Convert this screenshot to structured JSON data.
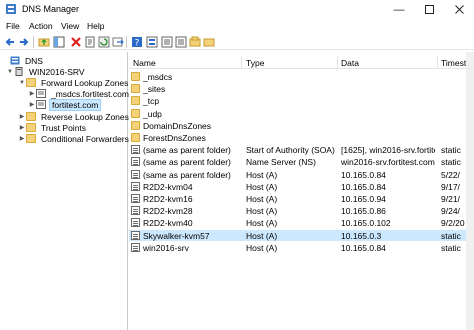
{
  "window": {
    "title": "DNS Manager"
  },
  "menu": [
    "File",
    "Action",
    "View",
    "Help"
  ],
  "toolbar": [
    "back-icon",
    "forward-icon",
    "up-folder-icon",
    "show-hide-tree-icon",
    "delete-icon",
    "properties-icon",
    "refresh-icon",
    "export-icon",
    "help-icon",
    "view-icon",
    "record-icon",
    "record2-icon",
    "domain-icon",
    "folder-icon"
  ],
  "tree": {
    "root": "DNS",
    "server": "WIN2016-SRV",
    "forward": "Forward Lookup Zones",
    "zone1": "_msdcs.fortitest.com",
    "zone2": "fortitest.com",
    "reverse": "Reverse Lookup Zones",
    "trust": "Trust Points",
    "cond": "Conditional Forwarders"
  },
  "columns": {
    "name": "Name",
    "type": "Type",
    "data": "Data",
    "ts": "Timestamp"
  },
  "rows": [
    {
      "name": "_msdcs",
      "type": "",
      "data": "",
      "ts": "",
      "kind": "folder"
    },
    {
      "name": "_sites",
      "type": "",
      "data": "",
      "ts": "",
      "kind": "folder"
    },
    {
      "name": "_tcp",
      "type": "",
      "data": "",
      "ts": "",
      "kind": "folder"
    },
    {
      "name": "_udp",
      "type": "",
      "data": "",
      "ts": "",
      "kind": "folder"
    },
    {
      "name": "DomainDnsZones",
      "type": "",
      "data": "",
      "ts": "",
      "kind": "folder"
    },
    {
      "name": "ForestDnsZones",
      "type": "",
      "data": "",
      "ts": "",
      "kind": "folder"
    },
    {
      "name": "(same as parent folder)",
      "type": "Start of Authority (SOA)",
      "data": "[1625], win2016-srv.fortite...",
      "ts": "static",
      "kind": "rec"
    },
    {
      "name": "(same as parent folder)",
      "type": "Name Server (NS)",
      "data": "win2016-srv.fortitest.com.",
      "ts": "static",
      "kind": "rec"
    },
    {
      "name": "(same as parent folder)",
      "type": "Host (A)",
      "data": "10.165.0.84",
      "ts": "5/22/",
      "kind": "rec"
    },
    {
      "name": "R2D2-kvm04",
      "type": "Host (A)",
      "data": "10.165.0.84",
      "ts": "9/17/",
      "kind": "rec"
    },
    {
      "name": "R2D2-kvm16",
      "type": "Host (A)",
      "data": "10.165.0.94",
      "ts": "9/21/",
      "kind": "rec"
    },
    {
      "name": "R2D2-kvm28",
      "type": "Host (A)",
      "data": "10.165.0.86",
      "ts": "9/24/",
      "kind": "rec"
    },
    {
      "name": "R2D2-kvm40",
      "type": "Host (A)",
      "data": "10.165.0.102",
      "ts": "9/2/20",
      "kind": "rec"
    },
    {
      "name": "Skywalker-kvm57",
      "type": "Host (A)",
      "data": "10.165.0.3",
      "ts": "static",
      "kind": "rec"
    },
    {
      "name": "win2016-srv",
      "type": "Host (A)",
      "data": "10.165.0.84",
      "ts": "static",
      "kind": "rec"
    }
  ]
}
